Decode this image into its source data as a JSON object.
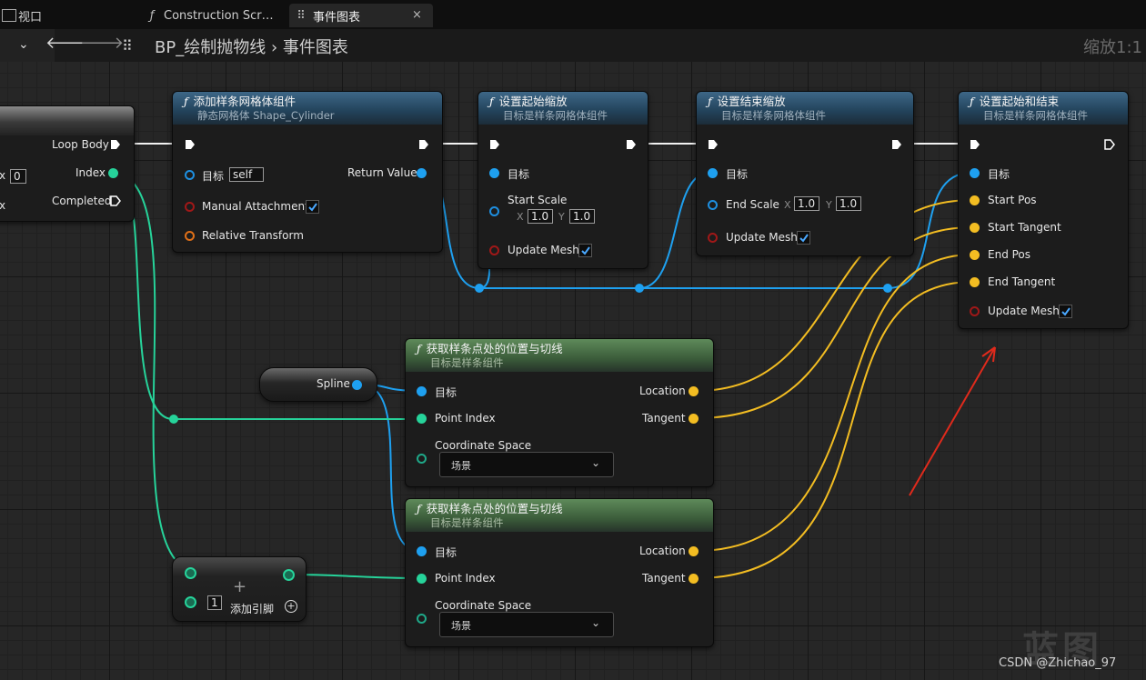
{
  "tabs": [
    {
      "label": "视口",
      "icon": "viewport-icon"
    },
    {
      "label": "Construction Scr…",
      "icon": "function-icon"
    },
    {
      "label": "事件图表",
      "icon": "graph-icon"
    }
  ],
  "tab_close": "×",
  "toolbar": {
    "back": "🡐",
    "forward": "🡒",
    "breadcrumb_root": "BP_绘制抛物线",
    "breadcrumb_sep": "›",
    "breadcrumb_current": "事件图表",
    "zoom": "缩放1:1"
  },
  "loop_node": {
    "loop_body": "Loop Body",
    "index": "Index",
    "completed": "Completed",
    "left_value": "0",
    "left_x1": "x",
    "left_x2": "x"
  },
  "add_spline_mesh": {
    "title": "添加样条网格体组件",
    "subtitle": "静态网格体 Shape_Cylinder",
    "target": "目标",
    "target_value": "self",
    "manual_attachment": "Manual Attachment",
    "relative_transform": "Relative Transform",
    "return_value": "Return Value"
  },
  "set_start_scale": {
    "title": "设置起始缩放",
    "subtitle": "目标是样条网格体组件",
    "target": "目标",
    "start_scale": "Start Scale",
    "x_label": "X",
    "x_value": "1.0",
    "y_label": "Y",
    "y_value": "1.0",
    "update_mesh": "Update Mesh"
  },
  "set_end_scale": {
    "title": "设置结束缩放",
    "subtitle": "目标是样条网格体组件",
    "target": "目标",
    "end_scale": "End Scale",
    "x_label": "X",
    "x_value": "1.0",
    "y_label": "Y",
    "y_value": "1.0",
    "update_mesh": "Update Mesh"
  },
  "set_start_end": {
    "title": "设置起始和结束",
    "subtitle": "目标是样条网格体组件",
    "target": "目标",
    "start_pos": "Start Pos",
    "start_tangent": "Start Tangent",
    "end_pos": "End Pos",
    "end_tangent": "End Tangent",
    "update_mesh": "Update Mesh"
  },
  "spline_var": {
    "label": "Spline"
  },
  "get_loc_tan_1": {
    "title": "获取样条点处的位置与切线",
    "subtitle": "目标是样条组件",
    "target": "目标",
    "point_index": "Point Index",
    "coord_space": "Coordinate Space",
    "coord_value": "场景",
    "location": "Location",
    "tangent": "Tangent"
  },
  "get_loc_tan_2": {
    "title": "获取样条点处的位置与切线",
    "subtitle": "目标是样条组件",
    "target": "目标",
    "point_index": "Point Index",
    "coord_space": "Coordinate Space",
    "coord_value": "场景",
    "location": "Location",
    "tangent": "Tangent"
  },
  "add_node": {
    "value": "1",
    "add_pin": "添加引脚"
  },
  "watermark": {
    "logo": "蓝图",
    "credit": "CSDN @Zhichao_97"
  },
  "colors": {
    "exec": "#ffffff",
    "object": "#1ea0f0",
    "integer": "#26d39a",
    "vector": "#f3bd22",
    "bool": "#a01818",
    "transform": "#e07018",
    "arrow": "#e02a1c"
  }
}
